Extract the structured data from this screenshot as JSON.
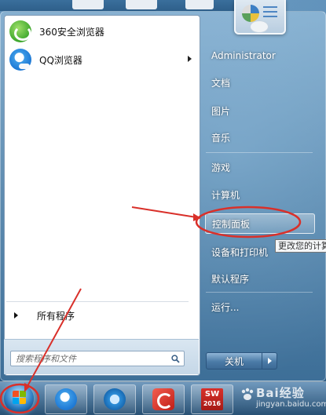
{
  "start_menu": {
    "pinned_programs": [
      {
        "label": "360安全浏览器",
        "icon": "360-browser-icon",
        "has_submenu": false
      },
      {
        "label": "QQ浏览器",
        "icon": "qq-browser-icon",
        "has_submenu": true
      }
    ],
    "all_programs_label": "所有程序",
    "search": {
      "placeholder": "搜索程序和文件"
    },
    "right_items": [
      {
        "label": "Administrator"
      },
      {
        "label": "文档"
      },
      {
        "label": "图片"
      },
      {
        "label": "音乐"
      },
      {
        "label": "游戏"
      },
      {
        "label": "计算机"
      },
      {
        "label": "控制面板",
        "highlighted": true
      },
      {
        "label": "设备和打印机"
      },
      {
        "label": "默认程序"
      },
      {
        "label": "运行..."
      }
    ],
    "tooltip": "更改您的计算机",
    "shutdown_label": "关机"
  },
  "taskbar": {
    "buttons": [
      {
        "icon": "qq-browser-icon"
      },
      {
        "icon": "internet-explorer-icon"
      },
      {
        "icon": "foxit-reader-icon"
      },
      {
        "icon": "solidworks-icon",
        "text": "SW",
        "year": "2016"
      }
    ]
  },
  "watermark": {
    "text": "Bai经验",
    "sub": "jingyan.baidu.com"
  },
  "colors": {
    "annotation": "#d9302a",
    "highlight_border": "#ffffff"
  }
}
